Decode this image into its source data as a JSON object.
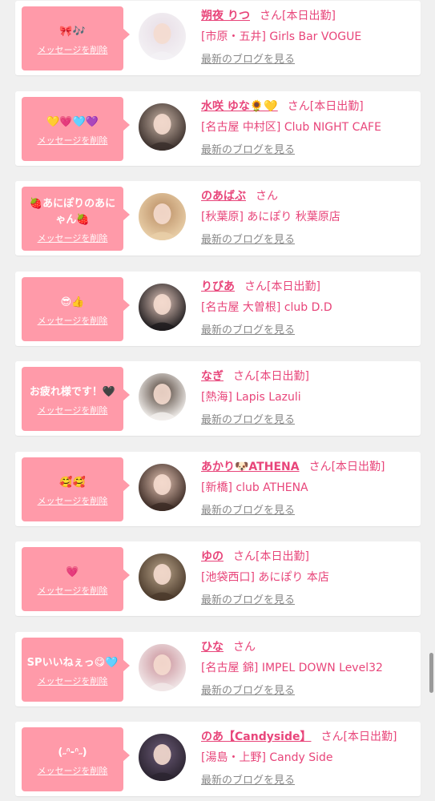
{
  "colors": {
    "accent": "#e8457a",
    "bubble": "#ff9aa9",
    "muted": "#888888"
  },
  "labels": {
    "delete_message": "メッセージを削除",
    "latest_blog": "最新のブログを見る",
    "honorific": "さん"
  },
  "items": [
    {
      "message": "🎀🎶",
      "name": "朔夜 りつ",
      "status": "[本日出勤]",
      "shop": "[市原・五井] Girls Bar VOGUE",
      "avatar_colors": [
        "#f3f1f4",
        "#e8dde6"
      ]
    },
    {
      "message": "💛💗🩵💜",
      "name": "水咲 ゆな🌻💛",
      "status": "[本日出勤]",
      "shop": "[名古屋 中村区] Club NIGHT CAFE",
      "avatar_colors": [
        "#3a2f2b",
        "#c9b4a6"
      ]
    },
    {
      "message": "🍓あにぽりのあにゃん🍓",
      "name": "のあばぶ",
      "status": "",
      "shop": "[秋葉原] あにぽり 秋葉原店",
      "avatar_colors": [
        "#e9cfa8",
        "#b98c63"
      ]
    },
    {
      "message": "😎👍",
      "name": "りびあ",
      "status": "[本日出勤]",
      "shop": "[名古屋 大曽根] club D.D",
      "avatar_colors": [
        "#1e1b1d",
        "#e4c8bd"
      ]
    },
    {
      "message": "お疲れ様です！🖤",
      "name": "なぎ",
      "status": "[本日出勤]",
      "shop": "[熱海] Lapis Lazuli",
      "avatar_colors": [
        "#f2efec",
        "#4a3a30"
      ]
    },
    {
      "message": "🥰🥰",
      "name": "あかり🐶ATHENA",
      "status": "[本日出勤]",
      "shop": "[新橋] club ATHENA",
      "avatar_colors": [
        "#3b2a24",
        "#e3c3b3"
      ]
    },
    {
      "message": "💗",
      "name": "ゆの",
      "status": "[本日出勤]",
      "shop": "[池袋西口] あにぽり 本店",
      "avatar_colors": [
        "#4b3a2b",
        "#b9a48a"
      ]
    },
    {
      "message": "SPいいねぇっ😋🩵",
      "name": "ひな",
      "status": "",
      "shop": "[名古屋 錦] IMPEL DOWN Level32",
      "avatar_colors": [
        "#f1e7e8",
        "#c98f98"
      ]
    },
    {
      "message": "(˶ᐢ-ᐢ˶)",
      "name": "のあ【Candyside】",
      "status": "[本日出勤]",
      "shop": "[湯島・上野] Candy Side",
      "avatar_colors": [
        "#2b2430",
        "#6a5a76"
      ]
    }
  ]
}
